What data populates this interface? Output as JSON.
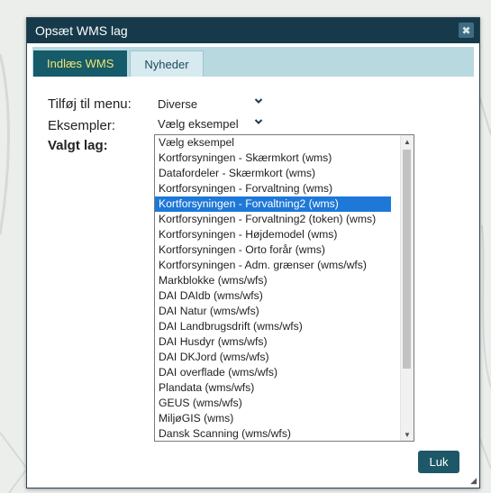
{
  "dialog": {
    "title": "Opsæt WMS lag",
    "close_label": "✖",
    "tabs": [
      {
        "label": "Indlæs WMS",
        "active": true
      },
      {
        "label": "Nyheder",
        "active": false
      }
    ]
  },
  "form": {
    "menu_label": "Tilføj til menu:",
    "menu_value": "Diverse",
    "examples_label": "Eksempler:",
    "examples_value": "Vælg eksempel",
    "selected_layer_label": "Valgt lag:"
  },
  "dropdown": {
    "selected_index": 4,
    "options": [
      "Vælg eksempel",
      "Kortforsyningen - Skærmkort (wms)",
      "Datafordeler - Skærmkort (wms)",
      "Kortforsyningen - Forvaltning (wms)",
      "Kortforsyningen - Forvaltning2 (wms)",
      "Kortforsyningen - Forvaltning2 (token) (wms)",
      "Kortforsyningen - Højdemodel (wms)",
      "Kortforsyningen - Orto forår (wms)",
      "Kortforsyningen - Adm. grænser (wms/wfs)",
      "Markblokke (wms/wfs)",
      "DAI DAIdb (wms/wfs)",
      "DAI Natur (wms/wfs)",
      "DAI Landbrugsdrift (wms/wfs)",
      "DAI Husdyr (wms/wfs)",
      "DAI DKJord (wms/wfs)",
      "DAI overflade (wms/wfs)",
      "Plandata (wms/wfs)",
      "GEUS (wms/wfs)",
      "MiljøGIS (wms)",
      "Dansk Scanning (wms/wfs)"
    ]
  },
  "footer": {
    "close_button_label": "Luk"
  },
  "colors": {
    "titlebar": "#163a4a",
    "tab_active_bg": "#155b6a",
    "tab_active_text": "#f4e56f",
    "selection": "#1e78d7",
    "button": "#1e5868"
  }
}
